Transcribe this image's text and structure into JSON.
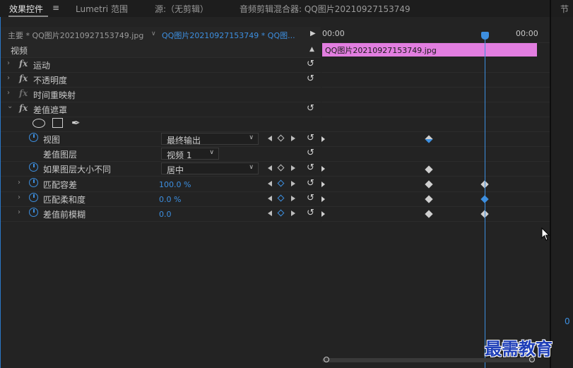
{
  "tabs": [
    {
      "label": "效果控件"
    },
    {
      "label": "≡"
    },
    {
      "label": "Lumetri 范围"
    },
    {
      "label": "源:（无剪辑）"
    },
    {
      "label": "音频剪辑混合器: QQ图片20210927153749"
    }
  ],
  "right_panel_title": "节",
  "clip_selector": {
    "master": "主要 * QQ图片20210927153749.jpg",
    "sequence": "QQ图片20210927153749 * QQ图...",
    "play_icon": "play-icon"
  },
  "timeline": {
    "time_start": "00:00",
    "time_end": "00:00",
    "clip_label": "QQ图片20210927153749.jpg",
    "clip_color": "#e27ee0",
    "playhead_color": "#3d8fe0"
  },
  "rows": {
    "video": "视频",
    "motion": "运动",
    "opacity": "不透明度",
    "time_remap": "时间重映射",
    "diff_matte": "差值遮罩",
    "view": {
      "label": "视图",
      "value": "最终输出"
    },
    "diff_layer": {
      "label": "差值图层",
      "value": "视频 1"
    },
    "if_size": {
      "label": "如果图层大小不同",
      "value": "居中"
    },
    "match_tol": {
      "label": "匹配容差",
      "value": "100.0 %"
    },
    "match_soft": {
      "label": "匹配柔和度",
      "value": "0.0 %"
    },
    "blur": {
      "label": "差值前模糊",
      "value": "0.0"
    }
  },
  "right_number": "0",
  "watermark": "最需教育",
  "accent_color": "#3d8fe0"
}
